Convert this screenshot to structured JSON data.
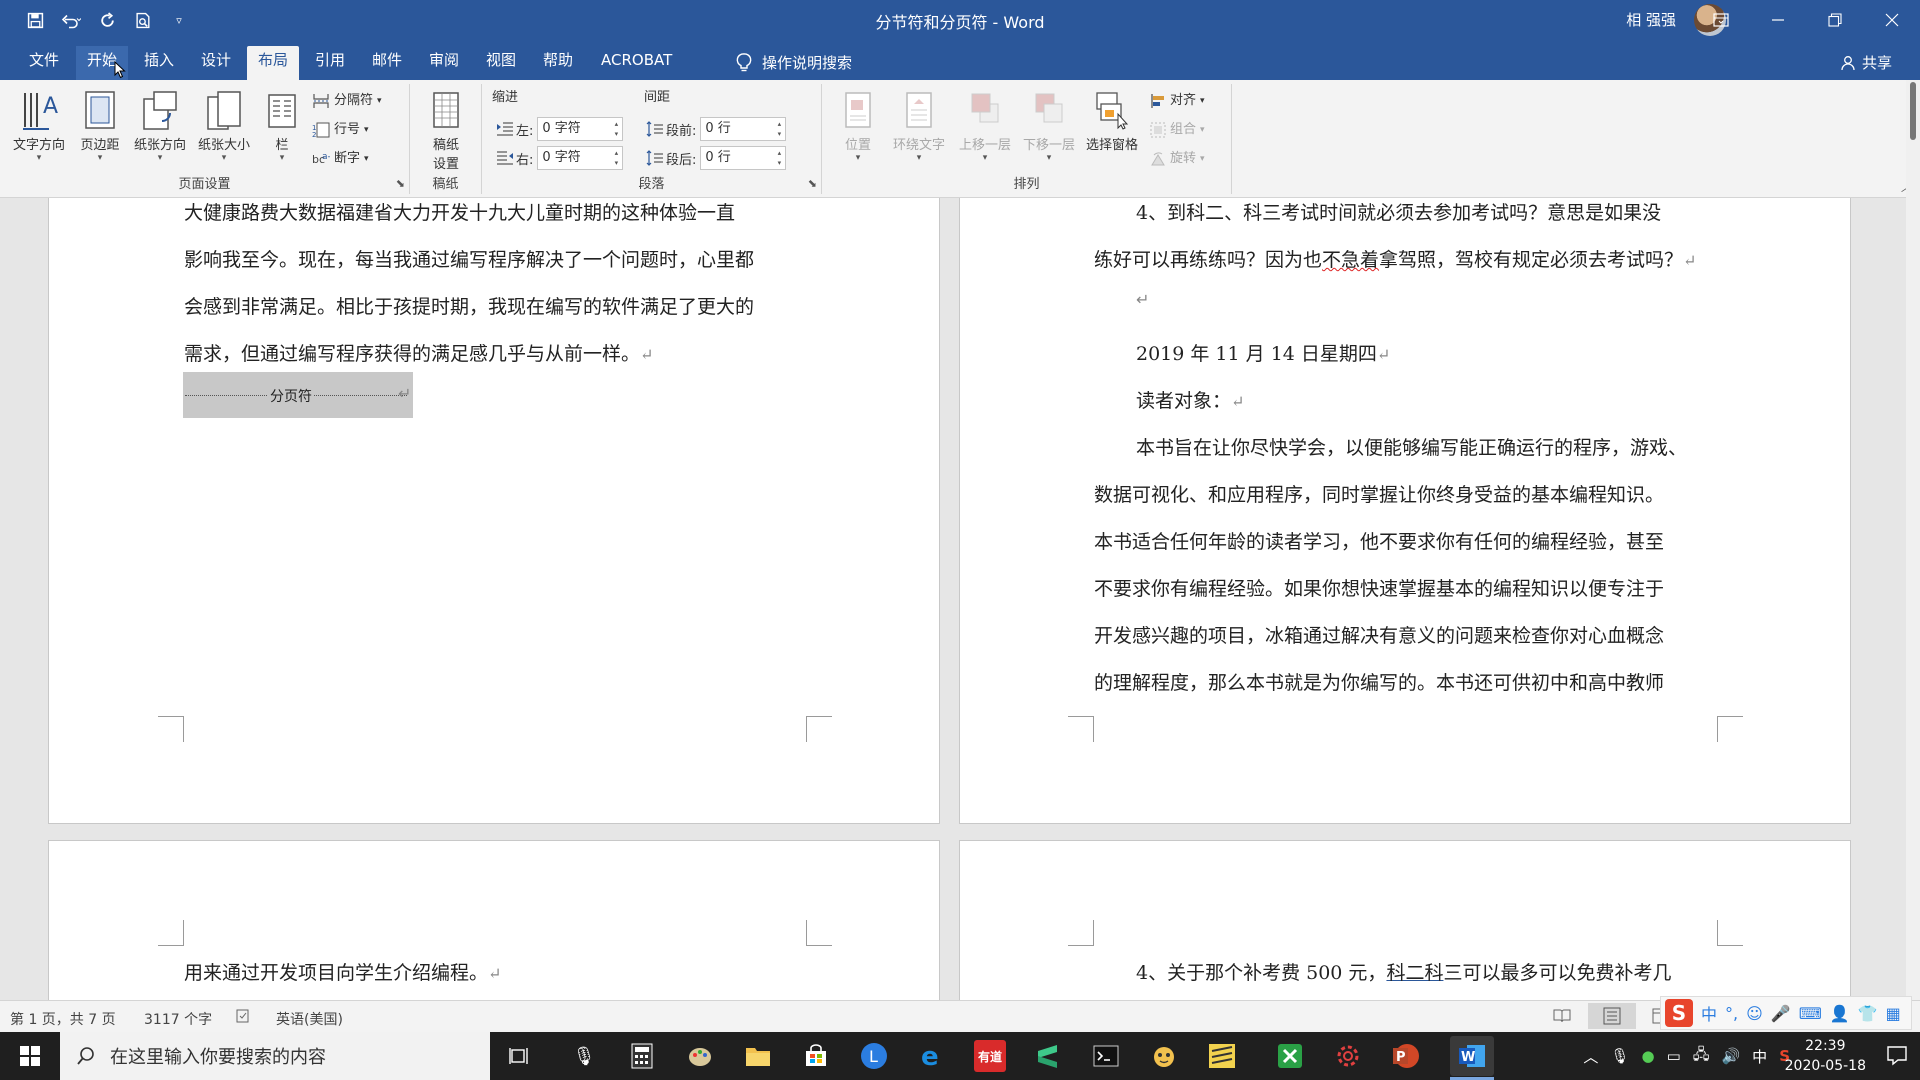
{
  "window": {
    "title": "分节符和分页符 - Word",
    "user_name": "相 强强"
  },
  "menu_tabs": [
    {
      "label": "文件"
    },
    {
      "label": "开始"
    },
    {
      "label": "插入"
    },
    {
      "label": "设计"
    },
    {
      "label": "布局"
    },
    {
      "label": "引用"
    },
    {
      "label": "邮件"
    },
    {
      "label": "审阅"
    },
    {
      "label": "视图"
    },
    {
      "label": "帮助"
    },
    {
      "label": "ACROBAT"
    }
  ],
  "active_tab": "布局",
  "tell_me": "操作说明搜索",
  "share": "共享",
  "ribbon": {
    "page_setup": {
      "label": "页面设置",
      "text_direction": "文字方向",
      "margins": "页边距",
      "orientation": "纸张方向",
      "size": "纸张大小",
      "columns": "栏",
      "breaks": "分隔符",
      "line_numbers": "行号",
      "hyphenation": "断字"
    },
    "manuscript": {
      "label": "稿纸",
      "button_line1": "稿纸",
      "button_line2": "设置"
    },
    "paragraph": {
      "label": "段落",
      "indent_header": "缩进",
      "spacing_header": "间距",
      "indent_left_label": "左:",
      "indent_left_value": "0 字符",
      "indent_right_label": "右:",
      "indent_right_value": "0 字符",
      "spacing_before_label": "段前:",
      "spacing_before_value": "0 行",
      "spacing_after_label": "段后:",
      "spacing_after_value": "0 行"
    },
    "arrange": {
      "label": "排列",
      "position": "位置",
      "wrap_text": "环绕文字",
      "bring_forward": "上移一层",
      "send_backward": "下移一层",
      "selection_pane": "选择窗格",
      "align": "对齐",
      "group": "组合",
      "rotate": "旋转"
    }
  },
  "document": {
    "left_page_lines": [
      "大健康路费大数据福建省大力开发十九大儿童时期的这种体验一直",
      "影响我至今。现在，每当我通过编写程序解决了一个问题时，心里都",
      "会感到非常满足。相比于孩提时期，我现在编写的软件满足了更大的",
      "需求，但通过编写程序获得的满足感几乎与从前一样。"
    ],
    "page_break_label": "分页符",
    "right_page": {
      "line1": "4、到科二、科三考试时间就必须去参加考试吗？意思是如果没",
      "line2_before": "练好可以再练练吗？因为也",
      "line2_squiggle": "不急着",
      "line2_after": "拿驾照，驾校有规定必须去考试吗？",
      "date": "2019 年 11 月 14 日星期四",
      "audience": "读者对象：",
      "body_lines": [
        "本书旨在让你尽快学会，以便能够编写能正确运行的程序，游戏、",
        "数据可视化、和应用程序，同时掌握让你终身受益的基本编程知识。",
        "本书适合任何年龄的读者学习，他不要求你有任何的编程经验，甚至",
        "不要求你有编程经验。如果你想快速掌握基本的编程知识以便专注于",
        "开发感兴趣的项目，冰箱通过解决有意义的问题来检查你对心血概念",
        "的理解程度，那么本书就是为你编写的。本书还可供初中和高中教师"
      ]
    },
    "bottom_left_line": "用来通过开发项目向学生介绍编程。",
    "bottom_right_before": "4、关于那个补考费 500 元，",
    "bottom_right_underlined": "科二科",
    "bottom_right_after": "三可以最多可以免费补考几"
  },
  "status_bar": {
    "page": "第 1 页，共 7 页",
    "words": "3117 个字",
    "language": "英语(美国)"
  },
  "taskbar": {
    "search_placeholder": "在这里输入你要搜索的内容",
    "time": "22:39",
    "date": "2020-05-18",
    "ime": "中"
  },
  "colors": {
    "word_blue": "#2b579a",
    "ribbon_bg": "#f3f3f3",
    "doc_bg": "#e6e6e6"
  }
}
